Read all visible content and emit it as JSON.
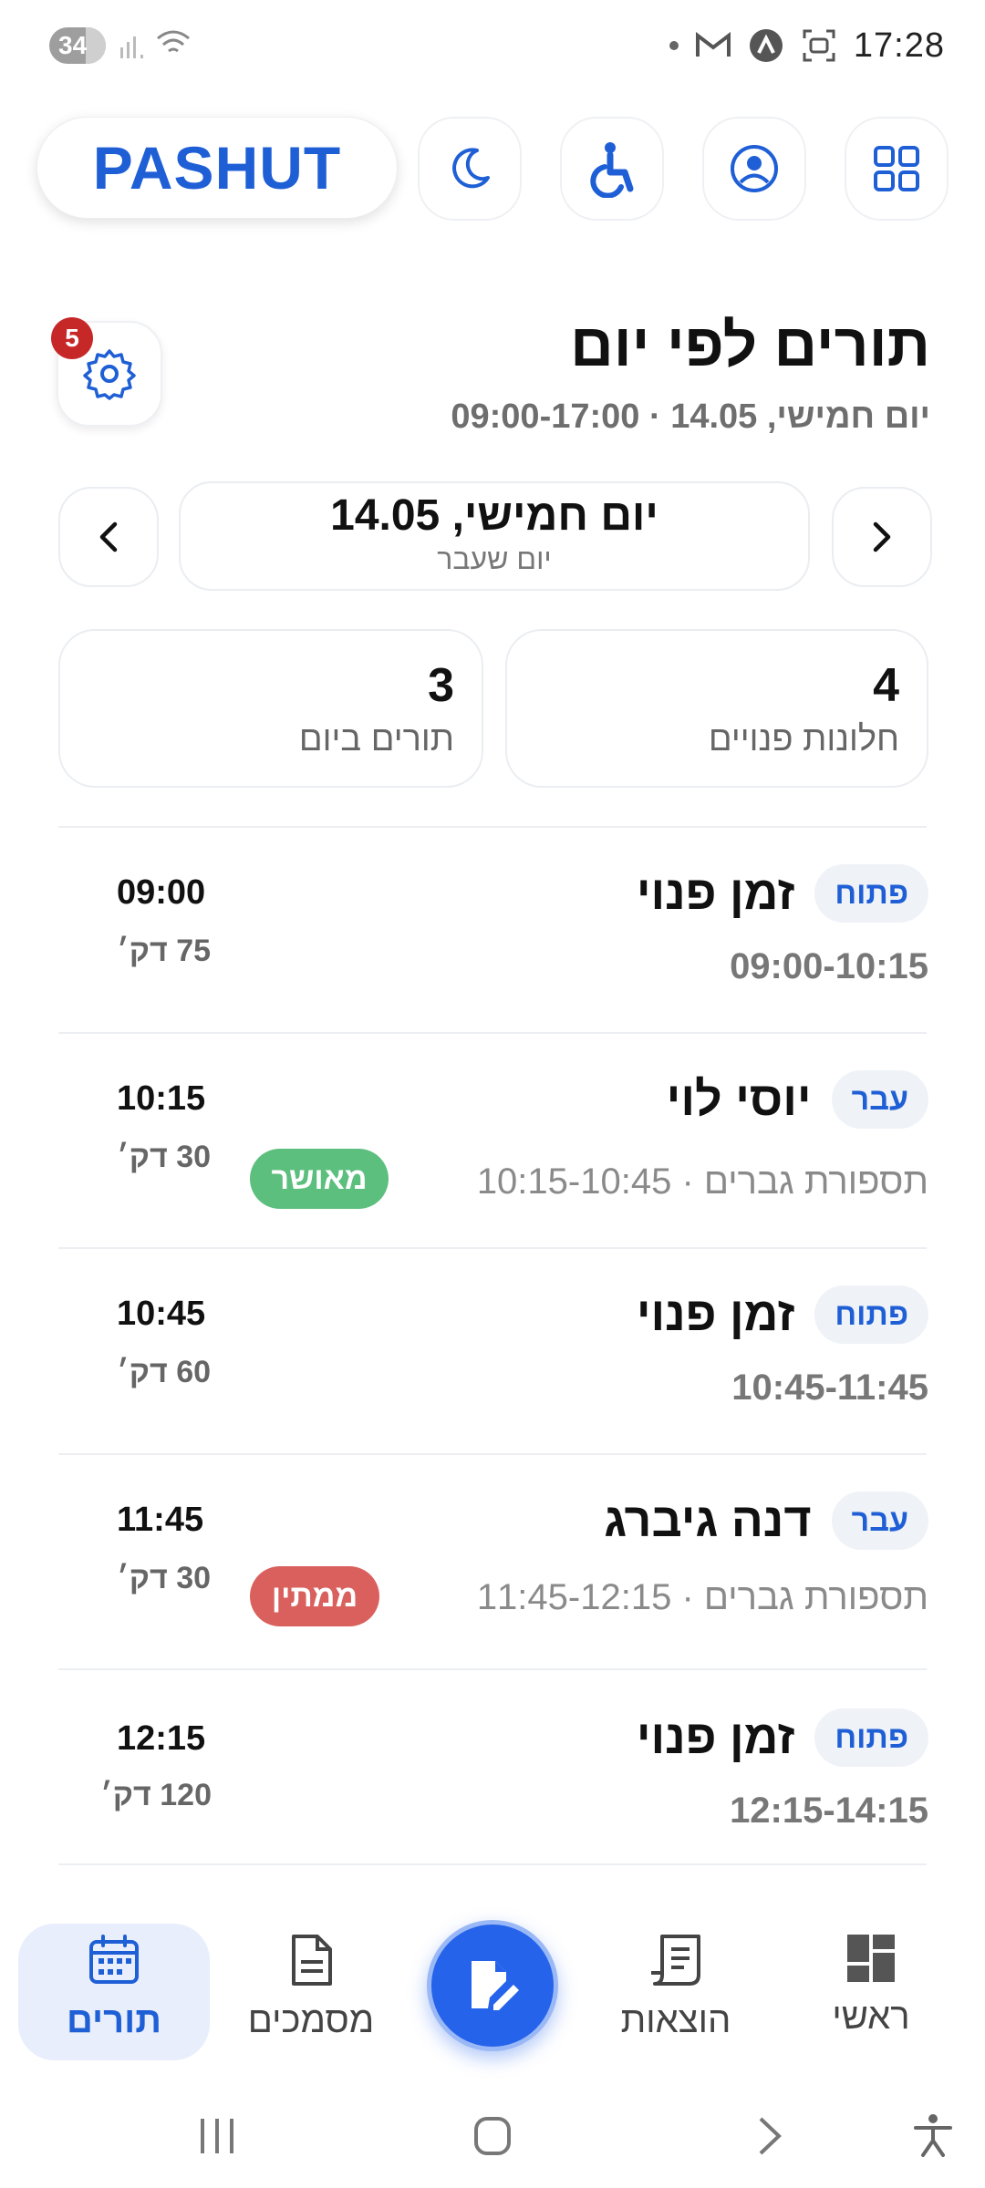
{
  "status_bar": {
    "battery": "34",
    "time": "17:28"
  },
  "header": {
    "logo": "PASHUT",
    "icons": [
      "moon-icon",
      "accessibility-icon",
      "profile-icon",
      "grid-icon"
    ]
  },
  "page": {
    "title": "תורים לפי יום",
    "subtitle": "יום חמישי, 14.05 · 09:00-17:00",
    "settings_badge": "5"
  },
  "date_nav": {
    "date": "יום חמישי, 14.05",
    "label": "יום שעבר"
  },
  "stats": [
    {
      "value": "4",
      "label": "חלונות פנויים"
    },
    {
      "value": "3",
      "label": "תורים ביום"
    }
  ],
  "slots": [
    {
      "chip": "פתוח",
      "title": "זמן פנוי",
      "sub": "09:00-10:15",
      "time": "09:00",
      "duration": "75 דק׳"
    },
    {
      "chip": "עבר",
      "title": "יוסי לוי",
      "sub": "תספורת גברים · 10:15-10:45",
      "time": "10:15",
      "duration": "30 דק׳",
      "status": "מאושר"
    },
    {
      "chip": "פתוח",
      "title": "זמן פנוי",
      "sub": "10:45-11:45",
      "time": "10:45",
      "duration": "60 דק׳"
    },
    {
      "chip": "עבר",
      "title": "דנה גיברג",
      "sub": "תספורת גברים · 11:45-12:15",
      "time": "11:45",
      "duration": "30 דק׳",
      "status": "ממתין"
    },
    {
      "chip": "פתוח",
      "title": "זמן פנוי",
      "sub": "12:15-14:15",
      "time": "12:15",
      "duration": "120 דק׳"
    }
  ],
  "bottom_nav": {
    "items": [
      "תורים",
      "מסמכים",
      "הוצאות",
      "ראשי"
    ]
  },
  "colors": {
    "accent": "#1f5fd6",
    "approved": "#5cbf7e",
    "pending": "#d9605d"
  }
}
